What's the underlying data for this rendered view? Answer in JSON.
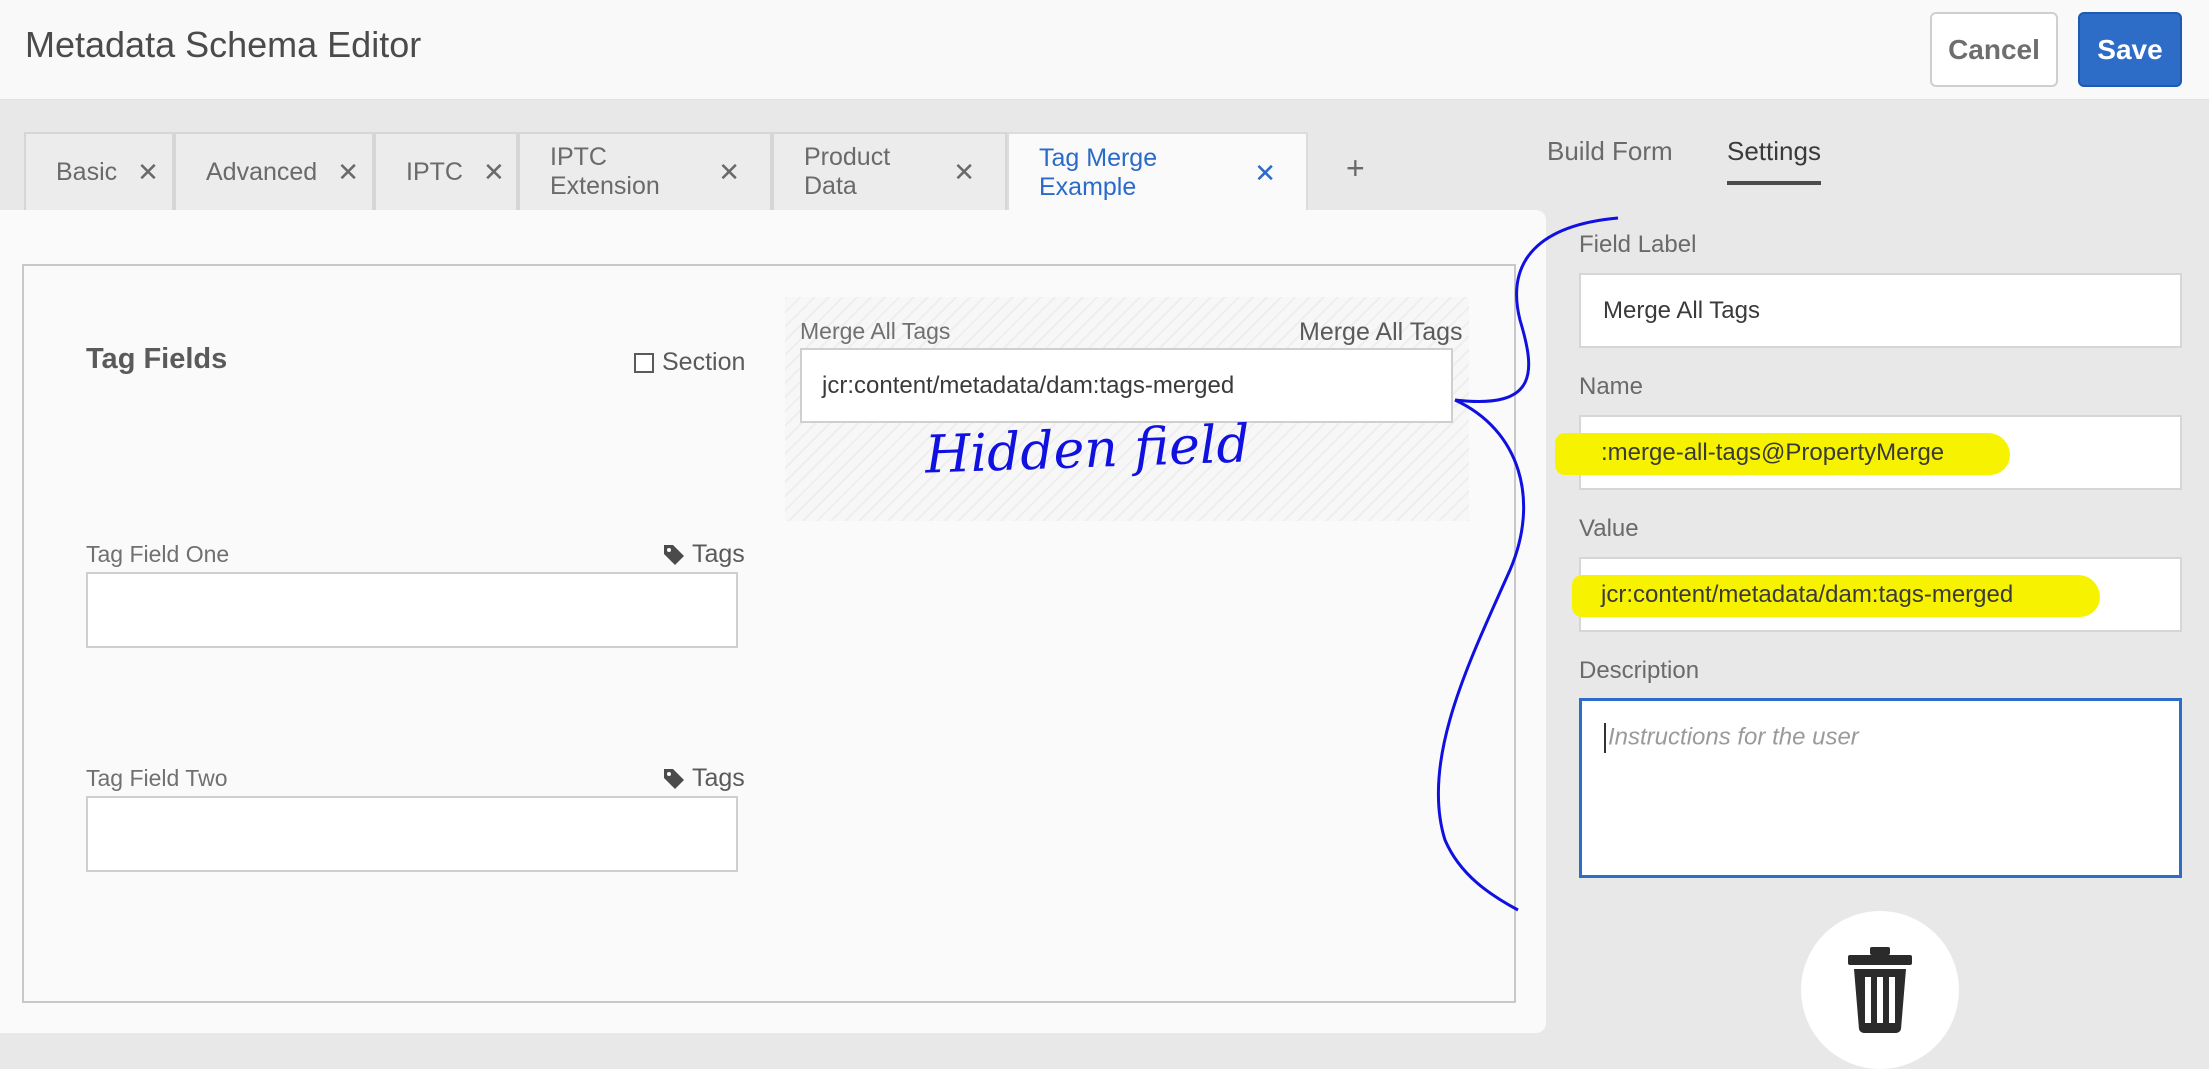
{
  "header": {
    "title": "Metadata Schema Editor",
    "cancel_label": "Cancel",
    "save_label": "Save"
  },
  "tabs": [
    {
      "label": "Basic"
    },
    {
      "label": "Advanced"
    },
    {
      "label": "IPTC"
    },
    {
      "label": "IPTC Extension"
    },
    {
      "label": "Product Data"
    },
    {
      "label": "Tag Merge Example",
      "active": true
    }
  ],
  "tab_close_glyph": "✕",
  "tab_add_glyph": "+",
  "canvas": {
    "section_title": "Tag Fields",
    "section_type": "Section",
    "field_one_label": "Tag Field One",
    "field_one_type": "Tags",
    "field_two_label": "Tag Field Two",
    "field_two_type": "Tags",
    "merge_label": "Merge All Tags",
    "merge_type": "Merge All Tags",
    "merge_value": "jcr:content/metadata/dam:tags-merged",
    "annotation": "Hidden field"
  },
  "settings": {
    "tab_build": "Build Form",
    "tab_settings": "Settings",
    "field_label_caption": "Field Label",
    "field_label_value": "Merge All Tags",
    "name_caption": "Name",
    "name_value": ":merge-all-tags@PropertyMerge",
    "value_caption": "Value",
    "value_value": "jcr:content/metadata/dam:tags-merged",
    "description_caption": "Description",
    "description_placeholder": "Instructions for the user"
  },
  "colors": {
    "accent": "#2d6dc8",
    "highlight": "#f7f300",
    "annotation": "#1010e0"
  }
}
